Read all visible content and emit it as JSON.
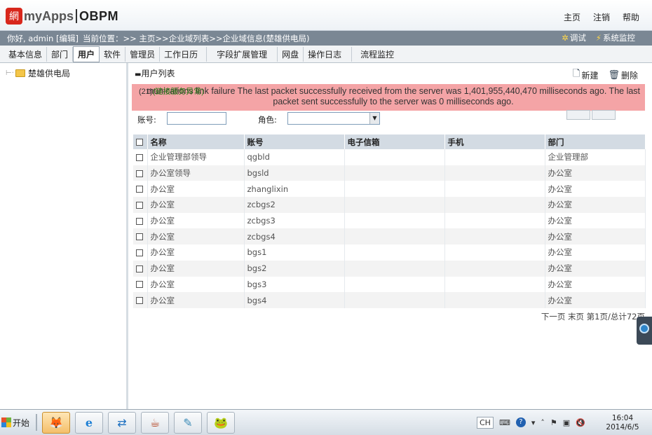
{
  "header": {
    "logo_seal": "網",
    "logo_text": "myApps",
    "logo_product": "OBPM",
    "links": [
      "主页",
      "注销",
      "帮助"
    ]
  },
  "infobar": {
    "greeting": "你好, admin [编辑]",
    "location": "当前位置：>> 主页>>企业域列表>>企业域信息(楚雄供电局)",
    "tools": [
      {
        "icon": "gear-icon",
        "label": "调试"
      },
      {
        "icon": "lightning-icon",
        "label": "系统监控"
      }
    ]
  },
  "nav": {
    "tabs": [
      "基本信息",
      "部门",
      "用户",
      "软件",
      "管理员",
      "工作日历",
      "字段扩展管理",
      "网盘",
      "操作日志",
      "流程监控"
    ],
    "active": "用户"
  },
  "tree": {
    "root_label": "楚雄供电局"
  },
  "main": {
    "title": "用户列表",
    "new_label": "新建",
    "delete_label": "删除"
  },
  "error": {
    "code": "(21)",
    "overlap_text": "(链接服务异常)",
    "message": "munications link failure The last packet successfully received from the server was 1,401,955,440,470 milliseconds ago. The last packet sent successfully to the server was 0 milliseconds ago."
  },
  "filters": {
    "account_label": "账号:",
    "account_value": "",
    "role_label": "角色:",
    "role_value": ""
  },
  "table": {
    "columns": [
      "名称",
      "账号",
      "电子信箱",
      "手机",
      "部门"
    ],
    "rows": [
      [
        "企业管理部领导",
        "qgbld",
        "",
        "",
        "企业管理部"
      ],
      [
        "办公室领导",
        "bgsld",
        "",
        "",
        "办公室"
      ],
      [
        "办公室",
        "zhanglixin",
        "",
        "",
        "办公室"
      ],
      [
        "办公室",
        "zcbgs2",
        "",
        "",
        "办公室"
      ],
      [
        "办公室",
        "zcbgs3",
        "",
        "",
        "办公室"
      ],
      [
        "办公室",
        "zcbgs4",
        "",
        "",
        "办公室"
      ],
      [
        "办公室",
        "bgs1",
        "",
        "",
        "办公室"
      ],
      [
        "办公室",
        "bgs2",
        "",
        "",
        "办公室"
      ],
      [
        "办公室",
        "bgs3",
        "",
        "",
        "办公室"
      ],
      [
        "办公室",
        "bgs4",
        "",
        "",
        "办公室"
      ]
    ]
  },
  "pager": "下一页 末页 第1页/总计72页",
  "taskbar": {
    "start_label": "开始",
    "apps": [
      "firefox-icon",
      "ie-icon",
      "teamviewer-icon",
      "java-icon",
      "notepad-icon",
      "frog-icon"
    ],
    "tray_lang": "CH",
    "time": "16:04",
    "date": "2014/6/5"
  },
  "colors": {
    "infobar_bg": "#7a8794",
    "error_bg": "#f4a4a6",
    "header_bg": "#eef2f6",
    "table_header_bg": "#d3dbe3"
  }
}
